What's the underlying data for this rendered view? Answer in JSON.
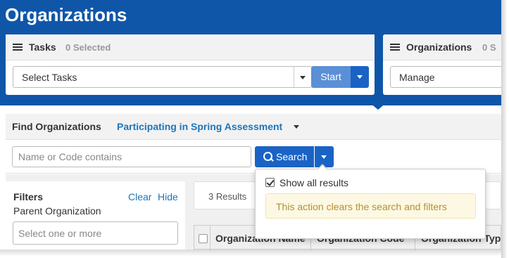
{
  "page": {
    "title": "Organizations"
  },
  "tasks_panel": {
    "title": "Tasks",
    "selected": "0 Selected",
    "select_value": "Select Tasks",
    "start_label": "Start"
  },
  "orgs_panel": {
    "title": "Organizations",
    "selected": "0 S",
    "select_value": "Manage"
  },
  "find": {
    "label": "Find Organizations",
    "filter_link": "Participating in Spring Assessment",
    "search_placeholder": "Name or Code contains",
    "search_label": "Search"
  },
  "search_dropdown": {
    "show_all_label": "Show all results",
    "show_all_checked": true,
    "warning": "This action clears the search and filters"
  },
  "filters": {
    "title": "Filters",
    "clear_label": "Clear",
    "hide_label": "Hide",
    "parent_label": "Parent Organization",
    "parent_placeholder": "Select one or more"
  },
  "results": {
    "count_label": "3 Results"
  },
  "table": {
    "columns": [
      "Organization Name",
      "Organization Code",
      "Organization Typ"
    ]
  },
  "colors": {
    "header_blue": "#0f56a8",
    "primary_button": "#1a63c6",
    "link": "#1b76bb",
    "warning_bg": "#fcf8e3",
    "warning_text": "#b5912f"
  }
}
